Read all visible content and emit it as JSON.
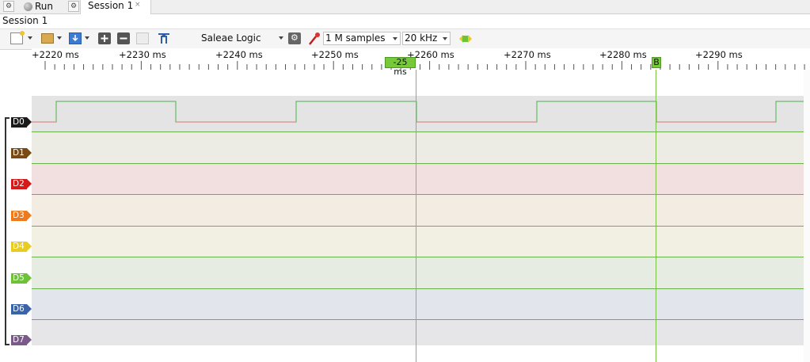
{
  "tabs": {
    "run_label": "Run",
    "session_label": "Session 1",
    "close_glyph": "×"
  },
  "session_title": "Session 1",
  "toolbar": {
    "device_name": "Saleae Logic",
    "sample_count": "1 M samples",
    "sample_rate": "20 kHz"
  },
  "timeline": {
    "tick_labels": [
      "+2220 ms",
      "+2230 ms",
      "+2240 ms",
      "+2250 ms",
      "+2260 ms",
      "+2270 ms",
      "+2280 ms",
      "+2290 ms"
    ],
    "marker_a_label": "-25 ms",
    "marker_b_label": "B"
  },
  "channels": [
    {
      "label": "D0",
      "color": "#1b1b1b",
      "band": "#e4e4e4"
    },
    {
      "label": "D1",
      "color": "#7a4a14",
      "band": "#ecebe4"
    },
    {
      "label": "D2",
      "color": "#d41a1a",
      "band": "#f2e0e0"
    },
    {
      "label": "D3",
      "color": "#ee7a1e",
      "band": "#f3ece2"
    },
    {
      "label": "D4",
      "color": "#e8cc22",
      "band": "#f1f0e2"
    },
    {
      "label": "D5",
      "color": "#6ec23a",
      "band": "#e6ece2"
    },
    {
      "label": "D6",
      "color": "#3a63a8",
      "band": "#e2e6ec"
    },
    {
      "label": "D7",
      "color": "#7a5a8a",
      "band": "#e6e6e8"
    }
  ],
  "colors": {
    "accent_green": "#77c93a",
    "signal_high": "#4caf50",
    "signal_low": "#d98a8a"
  }
}
